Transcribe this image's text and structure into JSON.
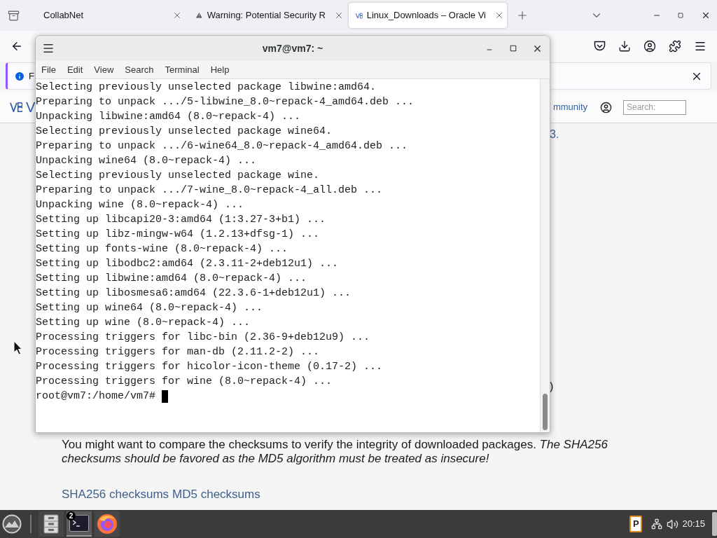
{
  "browser": {
    "tabs": [
      {
        "title": "CollabNet",
        "kind": "plain",
        "selected": false
      },
      {
        "title": "Warning: Potential Security R",
        "kind": "warning",
        "selected": false
      },
      {
        "title": "Linux_Downloads – Oracle Vi",
        "kind": "site",
        "selected": true
      }
    ]
  },
  "notification": {
    "text": "F"
  },
  "site_header": {
    "title": "V",
    "nav_link": "mmunity",
    "search": {
      "placeholder": "Search:"
    }
  },
  "page": {
    "fragment_1": "3.",
    "fragment_2": ")",
    "paragraph": "You might want to compare the checksums to verify the integrity of downloaded packages. *The SHA256 checksums should be favored as the MD5 algorithm must be treated as insecure!*",
    "links": [
      "SHA256 checksums",
      "MD5 checksums"
    ]
  },
  "terminal": {
    "title": "vm7@vm7: ~",
    "menu": [
      "File",
      "Edit",
      "View",
      "Search",
      "Terminal",
      "Help"
    ],
    "lines": [
      "Selecting previously unselected package libwine:amd64.",
      "Preparing to unpack .../5-libwine_8.0~repack-4_amd64.deb ...",
      "Unpacking libwine:amd64 (8.0~repack-4) ...",
      "Selecting previously unselected package wine64.",
      "Preparing to unpack .../6-wine64_8.0~repack-4_amd64.deb ...",
      "Unpacking wine64 (8.0~repack-4) ...",
      "Selecting previously unselected package wine.",
      "Preparing to unpack .../7-wine_8.0~repack-4_all.deb ...",
      "Unpacking wine (8.0~repack-4) ...",
      "Setting up libcapi20-3:amd64 (1:3.27-3+b1) ...",
      "Setting up libz-mingw-w64 (1.2.13+dfsg-1) ...",
      "Setting up fonts-wine (8.0~repack-4) ...",
      "Setting up libodbc2:amd64 (2.3.11-2+deb12u1) ...",
      "Setting up libwine:amd64 (8.0~repack-4) ...",
      "Setting up libosmesa6:amd64 (22.3.6-1+deb12u1) ...",
      "Setting up wine64 (8.0~repack-4) ...",
      "Setting up wine (8.0~repack-4) ...",
      "Processing triggers for libc-bin (2.36-9+deb12u9) ...",
      "Processing triggers for man-db (2.11.2-2) ...",
      "Processing triggers for hicolor-icon-theme (0.17-2) ...",
      "Processing triggers for wine (8.0~repack-4) ..."
    ],
    "prompt": "root@vm7:/home/vm7#"
  },
  "taskbar": {
    "apps": [
      {
        "kind": "files",
        "selected": false
      },
      {
        "kind": "terminal",
        "selected": true,
        "badge": "2"
      },
      {
        "kind": "browser",
        "selected": false
      }
    ],
    "tray_letter": "P",
    "clock": "20:15"
  }
}
